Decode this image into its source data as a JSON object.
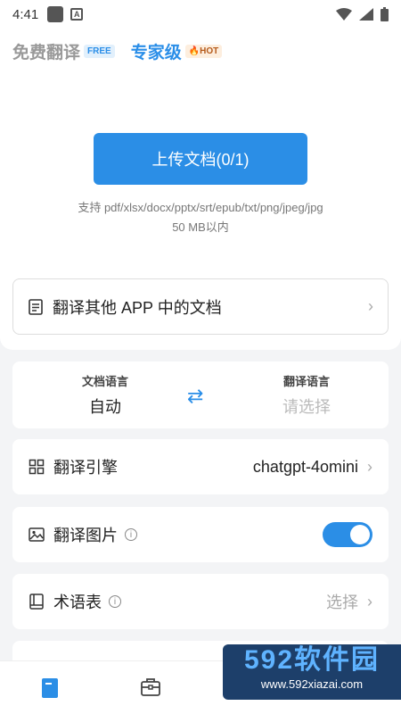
{
  "status": {
    "time": "4:41"
  },
  "tabs": [
    {
      "label": "免费翻译",
      "badge": "FREE"
    },
    {
      "label": "专家级",
      "badge": "HOT"
    }
  ],
  "upload": {
    "button_label": "上传文档(0/1)",
    "support_line1": "支持 pdf/xlsx/docx/pptx/srt/epub/txt/png/jpeg/jpg",
    "support_line2": "50 MB以内"
  },
  "other_app": {
    "label": "翻译其他 APP 中的文档"
  },
  "language": {
    "source_caption": "文档语言",
    "source_value": "自动",
    "target_caption": "翻译语言",
    "target_placeholder": "请选择"
  },
  "engine": {
    "label": "翻译引擎",
    "value": "chatgpt-4omini"
  },
  "translate_images": {
    "label": "翻译图片",
    "enabled": true
  },
  "glossary": {
    "label": "术语表",
    "value": "选择"
  },
  "watermark": {
    "big": "592软件园",
    "small": "www.592xiazai.com"
  },
  "colors": {
    "accent": "#2b8ee6"
  }
}
